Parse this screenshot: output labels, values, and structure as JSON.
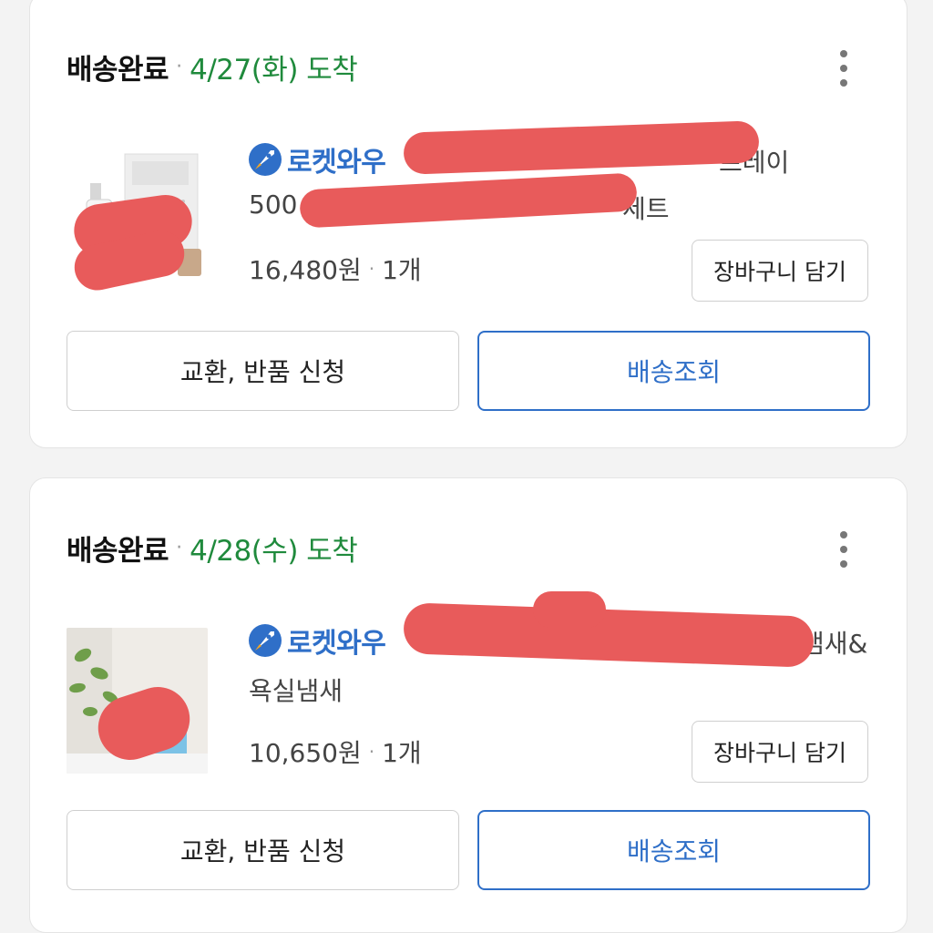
{
  "orders": [
    {
      "status": "배송완료",
      "separator": "·",
      "arrival": "4/27(화) 도착",
      "badge": "로켓와우",
      "title_tail": "프레이",
      "title_line2_start": "500",
      "title_line2_end": "세트",
      "price": "16,480원",
      "qty": "1개",
      "cart_label": "장바구니 담기",
      "exchange_label": "교환, 반품 신청",
      "track_label": "배송조회"
    },
    {
      "status": "배송완료",
      "separator": "·",
      "arrival": "4/28(수) 도착",
      "badge": "로켓와우",
      "title_tail": "냄새&",
      "title_line2": "욕실냄새",
      "price": "10,650원",
      "qty": "1개",
      "cart_label": "장바구니 담기",
      "exchange_label": "교환, 반품 신청",
      "track_label": "배송조회"
    }
  ],
  "colors": {
    "arrival": "#1f8a3c",
    "brand_blue": "#2f6fc8",
    "redaction": "#e85b5b"
  },
  "icons": {
    "more": "more-vertical-icon",
    "rocket": "rocket-icon"
  }
}
